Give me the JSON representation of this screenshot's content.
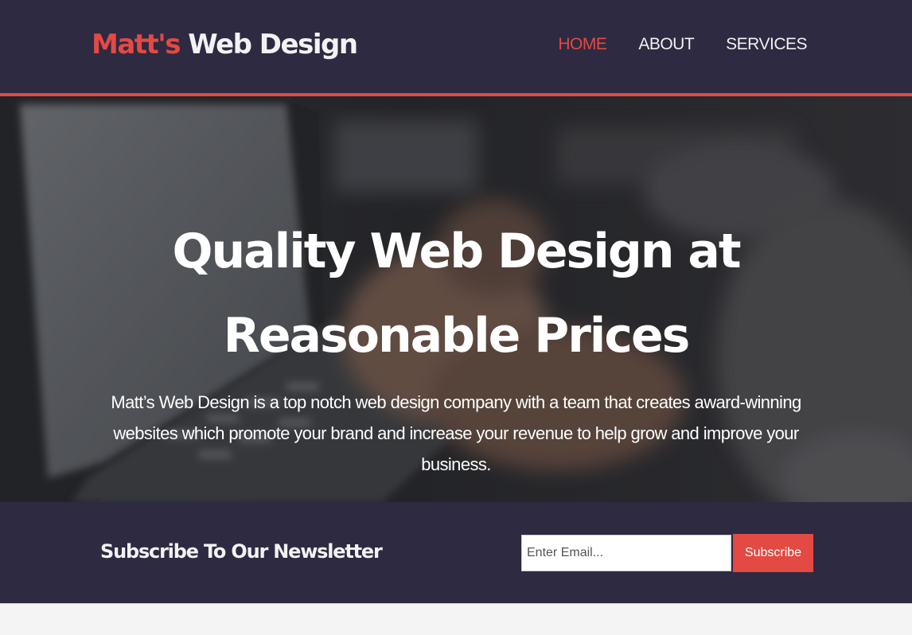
{
  "header": {
    "brand_part1": "Matt's",
    "brand_part2": "Web Design",
    "nav": [
      {
        "label": "HOME",
        "active": true
      },
      {
        "label": "ABOUT",
        "active": false
      },
      {
        "label": "SERVICES",
        "active": false
      }
    ]
  },
  "hero": {
    "title": "Quality Web Design at Reasonable Prices",
    "text": "Matt’s Web Design is a top notch web design company with a team that creates award-winning websites which promote your brand and increase your revenue to help grow and improve your business.",
    "background": "laptop-typing-photo"
  },
  "newsletter": {
    "title": "Subscribe To Our Newsletter",
    "email_placeholder": "Enter Email...",
    "email_value": "",
    "button_label": "Subscribe"
  },
  "colors": {
    "header_bg": "#2e2a42",
    "accent": "#e24a43",
    "text_light": "#f2f2f2"
  }
}
